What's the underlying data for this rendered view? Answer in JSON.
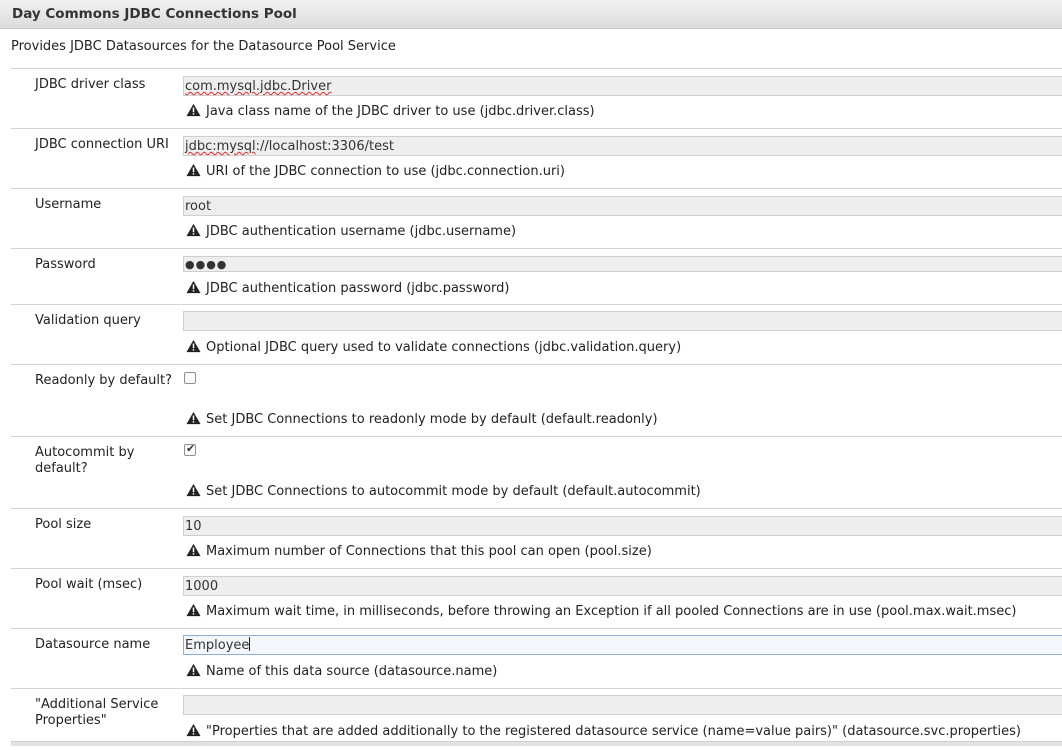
{
  "panel": {
    "title": "Day Commons JDBC Connections Pool",
    "description": "Provides JDBC Datasources for the Datasource Pool Service"
  },
  "fields": {
    "driver_class": {
      "label": "JDBC driver class",
      "value_a": "com.mysql.jdbc.Driver",
      "hint": "Java class name of the JDBC driver to use (jdbc.driver.class)"
    },
    "connection_uri": {
      "label": "JDBC connection URI",
      "value_a": "jdbc:mysql",
      "value_b": "://localhost:3306/test",
      "hint": "URI of the JDBC connection to use (jdbc.connection.uri)"
    },
    "username": {
      "label": "Username",
      "value": "root",
      "hint": "JDBC authentication username (jdbc.username)"
    },
    "password": {
      "label": "Password",
      "value": "●●●●",
      "hint": "JDBC authentication password (jdbc.password)"
    },
    "validation_query": {
      "label": "Validation query",
      "value": "",
      "hint": "Optional JDBC query used to validate connections (jdbc.validation.query)"
    },
    "readonly": {
      "label": "Readonly by default?",
      "checked": false,
      "hint": "Set JDBC Connections to readonly mode by default (default.readonly)"
    },
    "autocommit": {
      "label": "Autocommit by default?",
      "checked": true,
      "check_glyph": "✔",
      "hint": "Set JDBC Connections to autocommit mode by default (default.autocommit)"
    },
    "pool_size": {
      "label": "Pool size",
      "value": "10",
      "hint": "Maximum number of Connections that this pool can open (pool.size)"
    },
    "pool_wait": {
      "label": "Pool wait (msec)",
      "value": "1000",
      "hint": "Maximum wait time, in milliseconds, before throwing an Exception if all pooled Connections are in use (pool.max.wait.msec)"
    },
    "datasource_name": {
      "label": "Datasource name",
      "value": "Employee",
      "hint": "Name of this data source (datasource.name)"
    },
    "additional_props": {
      "label": "\"Additional Service Properties\"",
      "value": "",
      "hint": "\"Properties that are added additionally to the registered datasource service (name=value pairs)\" (datasource.svc.properties)"
    }
  },
  "icons": {
    "warning": "warning-icon"
  },
  "colors": {
    "field_bg": "#eeeeee",
    "focus_border": "#8ab0d8",
    "spell_underline": "#e03030"
  }
}
